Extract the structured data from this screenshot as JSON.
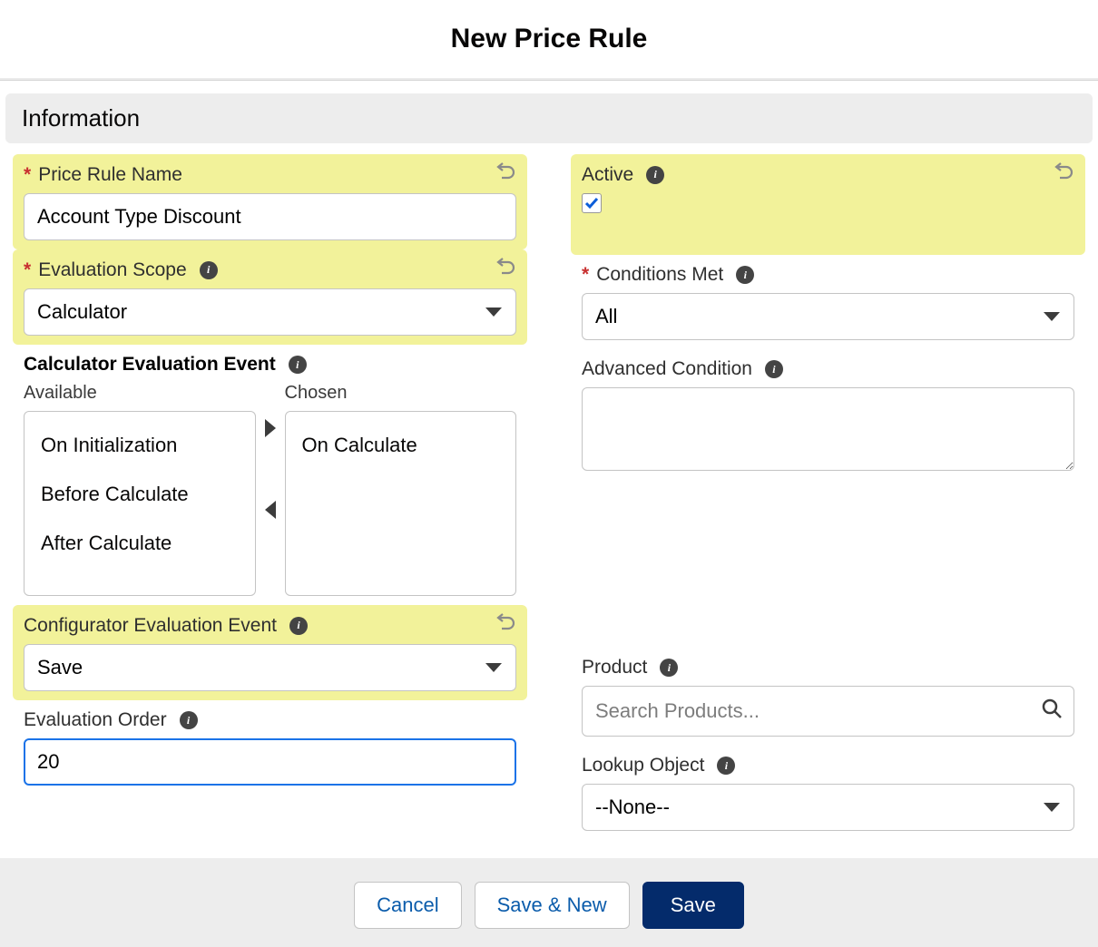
{
  "page": {
    "title": "New Price Rule"
  },
  "section": {
    "information": "Information"
  },
  "fields": {
    "price_rule_name": {
      "label": "Price Rule Name",
      "value": "Account Type Discount",
      "required": true
    },
    "evaluation_scope": {
      "label": "Evaluation Scope",
      "value": "Calculator",
      "required": true
    },
    "calc_eval_event": {
      "label": "Calculator Evaluation Event",
      "available_label": "Available",
      "chosen_label": "Chosen",
      "available": [
        "On Initialization",
        "Before Calculate",
        "After Calculate"
      ],
      "chosen": [
        "On Calculate"
      ]
    },
    "config_eval_event": {
      "label": "Configurator Evaluation Event",
      "value": "Save"
    },
    "evaluation_order": {
      "label": "Evaluation Order",
      "value": "20"
    },
    "active": {
      "label": "Active",
      "checked": true
    },
    "conditions_met": {
      "label": "Conditions Met",
      "value": "All",
      "required": true
    },
    "advanced_condition": {
      "label": "Advanced Condition",
      "value": ""
    },
    "product": {
      "label": "Product",
      "placeholder": "Search Products..."
    },
    "lookup_object": {
      "label": "Lookup Object",
      "value": "--None--"
    }
  },
  "buttons": {
    "cancel": "Cancel",
    "save_new": "Save & New",
    "save": "Save"
  }
}
